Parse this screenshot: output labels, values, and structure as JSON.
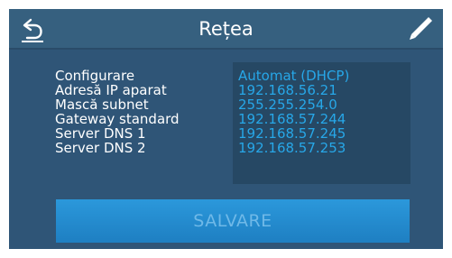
{
  "header": {
    "title": "Rețea",
    "back_icon": "back-arrow-icon",
    "edit_icon": "pencil-icon"
  },
  "network": {
    "rows": [
      {
        "label": "Configurare",
        "value": "Automat (DHCP)"
      },
      {
        "label": "Adresă IP aparat",
        "value": "192.168.56.21"
      },
      {
        "label": "Mască subnet",
        "value": "255.255.254.0"
      },
      {
        "label": "Gateway standard",
        "value": "192.168.57.244"
      },
      {
        "label": "Server DNS 1",
        "value": "192.168.57.245"
      },
      {
        "label": "Server DNS 2",
        "value": "192.168.57.253"
      }
    ]
  },
  "footer": {
    "save_label": "SALVARE"
  },
  "colors": {
    "background": "#2f5577",
    "header": "#36607f",
    "panel": "#264864",
    "value_text": "#27a7e8",
    "button": "#1e88cf",
    "button_text_disabled": "#6fb9e8"
  }
}
